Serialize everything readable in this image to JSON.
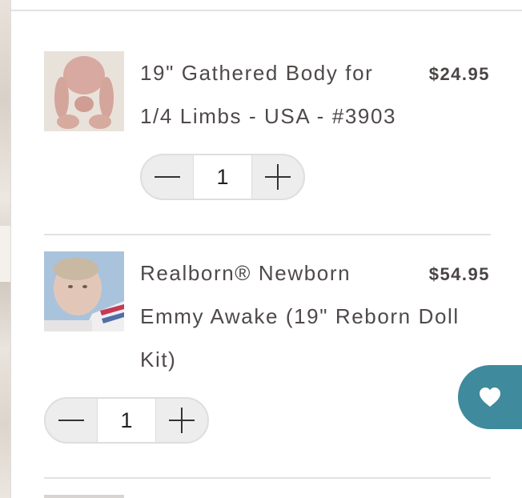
{
  "cart": {
    "items": [
      {
        "title_line1": "19\" Gathered Body for",
        "title_line2": "1/4 Limbs - USA - #3903",
        "title_line3": "",
        "price": "$24.95",
        "quantity": "1",
        "thumbnail": "doll-body-thumbnail"
      },
      {
        "title_line1": "Realborn® Newborn",
        "title_line2": "Emmy Awake (19\" Reborn Doll",
        "title_line3": "Kit)",
        "price": "$54.95",
        "quantity": "1",
        "thumbnail": "reborn-doll-thumbnail"
      }
    ]
  },
  "icons": {
    "decrease": "minus-icon",
    "increase": "plus-icon",
    "favorite": "heart-icon"
  },
  "colors": {
    "text": "#4f4949",
    "price": "#4a4444",
    "stepper_bg": "#ededed",
    "stepper_border": "#dedede",
    "favorite_bg": "#3f8a9c",
    "divider": "#e2e2e2"
  }
}
